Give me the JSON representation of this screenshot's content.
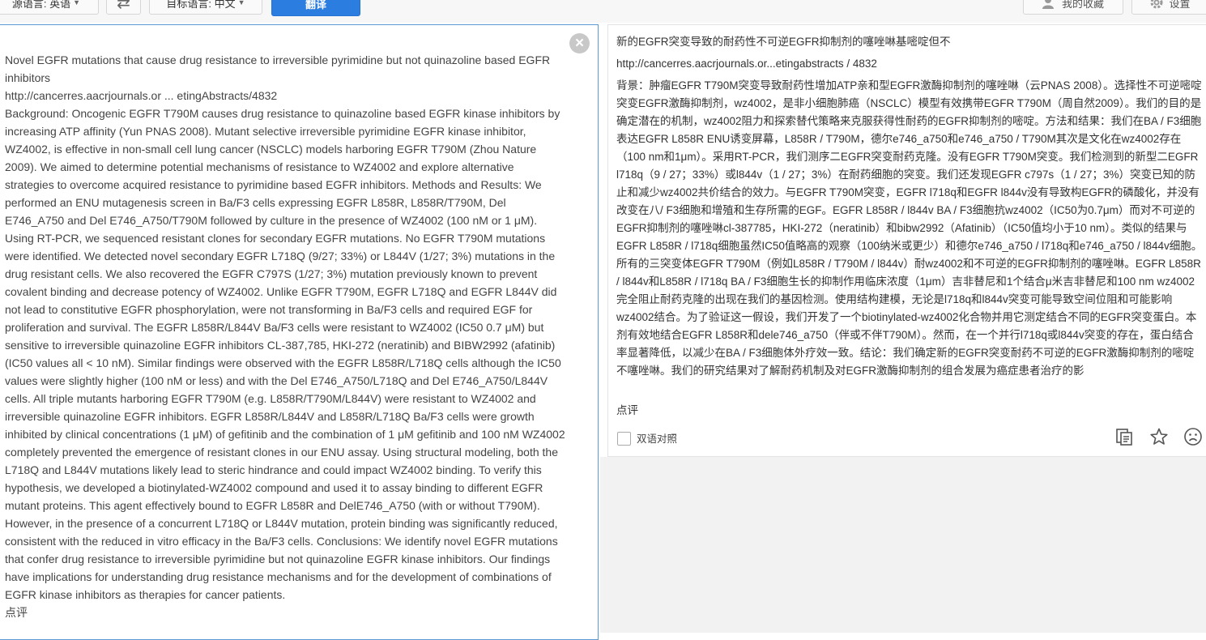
{
  "toolbar": {
    "source_language": "源语言: 英语",
    "target_language": "目标语言: 中文",
    "translate_label": "翻译",
    "favorites_label": "我的收藏",
    "settings_label": "设置"
  },
  "source": {
    "paragraphs": [
      "Novel EGFR mutations that cause drug resistance to irreversible pyrimidine but not quinazoline based EGFR inhibitors",
      "http://cancerres.aacrjournals.or ... etingAbstracts/4832",
      "Background: Oncogenic EGFR T790M causes drug resistance to quinazoline based EGFR kinase inhibitors by increasing ATP affinity (Yun PNAS 2008). Mutant selective irreversible pyrimidine EGFR kinase inhibitor, WZ4002, is effective in non-small cell lung cancer (NSCLC) models harboring EGFR T790M (Zhou Nature 2009). We aimed to determine potential mechanisms of resistance to WZ4002 and explore alternative strategies to overcome acquired resistance to pyrimidine based EGFR inhibitors. Methods and Results: We performed an ENU mutagenesis screen in Ba/F3 cells expressing EGFR L858R, L858R/T790M, Del E746_A750 and Del E746_A750/T790M followed by culture in the presence of WZ4002 (100 nM or 1 μM). Using RT-PCR, we sequenced resistant clones for secondary EGFR mutations. No EGFR T790M mutations were identified. We detected novel secondary EGFR L718Q (9/27; 33%) or L844V (1/27; 3%) mutations in the drug resistant cells. We also recovered the EGFR C797S (1/27; 3%) mutation previously known to prevent covalent binding and decrease potency of WZ4002. Unlike EGFR T790M, EGFR L718Q and EGFR L844V did not lead to constitutive EGFR phosphorylation, were not transforming in Ba/F3 cells and required EGF for proliferation and survival. The EGFR L858R/L844V Ba/F3 cells were resistant to WZ4002 (IC50 0.7 μM) but sensitive to irreversible quinazoline EGFR inhibitors CL-387,785, HKI-272 (neratinib) and BIBW2992 (afatinib) (IC50 values all < 10 nM). Similar findings were observed with the EGFR L858R/L718Q cells although the IC50 values were slightly higher (100 nM or less) and with the Del E746_A750/L718Q and Del E746_A750/L844V cells. All triple mutants harboring EGFR T790M (e.g. L858R/T790M/L844V) were resistant to WZ4002 and irreversible quinazoline EGFR inhibitors. EGFR L858R/L844V and L858R/L718Q Ba/F3 cells were growth inhibited by clinical concentrations (1 μM) of gefitinib and the combination of 1 μM gefitinib and 100 nM WZ4002 completely prevented the emergence of resistant clones in our ENU assay. Using structural modeling, both the L718Q and L844V mutations likely lead to steric hindrance and could impact WZ4002 binding. To verify this hypothesis, we developed a biotinylated-WZ4002 compound and used it to assay binding to different EGFR mutant proteins. This agent effectively bound to EGFR L858R and DelE746_A750 (with or without T790M). However, in the presence of a concurrent L718Q or L844V mutation, protein binding was significantly reduced, consistent with the reduced in vitro efficacy in the Ba/F3 cells. Conclusions: We identify novel EGFR mutations that confer drug resistance to irreversible pyrimidine but not quinazoline EGFR kinase inhibitors. Our findings have implications for understanding drug resistance mechanisms and for the development of combinations of EGFR kinase inhibitors as therapies for cancer patients.",
      "点评"
    ]
  },
  "result": {
    "title": "新的EGFR突变导致的耐药性不可逆EGFR抑制剂的噻唑啉基嘧啶但不",
    "link": "http://cancerres.aacrjournals.or...etingabstracts / 4832",
    "body": "背景：肿瘤EGFR T790M突变导致耐药性增加ATP亲和型EGFR激酶抑制剂的噻唑啉（云PNAS 2008）。选择性不可逆嘧啶突变EGFR激酶抑制剂，wz4002，是非小细胞肺癌（NSCLC）模型有效携带EGFR T790M（周自然2009）。我们的目的是确定潜在的机制，wz4002阻力和探索替代策略来克服获得性耐药的EGFR抑制剂的嘧啶。方法和结果：我们在BA / F3细胞表达EGFR L858R ENU诱变屏幕，L858R / T790M，德尔e746_a750和e746_a750 / T790M其次是文化在wz4002存在（100 nm和1μm）。采用RT-PCR，我们测序二EGFR突变耐药克隆。没有EGFR T790M突变。我们检测到的新型二EGFR l718q（9 / 27；33%）或l844v（1 / 27；3%）在耐药细胞的突变。我们还发现EGFR c797s（1 / 27；3%）突变已知的防止和减少wz4002共价结合的效力。与EGFR T790M突变，EGFR l718q和EGFR l844v没有导致构EGFR的磷酸化，并没有改变在八/ F3细胞和增殖和生存所需的EGF。EGFR L858R / l844v BA / F3细胞抗wz4002（IC50为0.7μm）而对不可逆的EGFR抑制剂的噻唑啉cl-387785，HKI-272（neratinib）和bibw2992（Afatinib）（IC50值均小于10 nm）。类似的结果与EGFR L858R / l718q细胞虽然IC50值略高的观察（100纳米或更少）和德尔e746_a750 / l718q和e746_a750 / l844v细胞。所有的三突变体EGFR T790M（例如L858R / T790M / l844v）耐wz4002和不可逆的EGFR抑制剂的噻唑啉。EGFR L858R / l844v和L858R / l718q BA / F3细胞生长的抑制作用临床浓度（1μm）吉非替尼和1个结合μ米吉非替尼和100 nm wz4002完全阻止耐药克隆的出现在我们的基因检测。使用结构建模，无论是l718q和l844v突变可能导致空间位阻和可能影响wz4002结合。为了验证这一假设，我们开发了一个biotinylated-wz4002化合物并用它测定结合不同的EGFR突变蛋白。本剂有效地结合EGFR L858R和dele746_a750（伴或不伴T790M）。然而，在一个并行l718q或l844v突变的存在，蛋白结合率显著降低，以减少在BA / F3细胞体外疗效一致。结论：我们确定新的EGFR突变耐药不可逆的EGFR激酶抑制剂的嘧啶不噻唑啉。我们的研究结果对了解耐药机制及对EGFR激酶抑制剂的组合发展为癌症患者治疗的影",
    "comment": "点评",
    "bilingual_label": "双语对照"
  },
  "icons": [
    "chevron-down-icon",
    "swap-arrows-icon",
    "close-icon",
    "favorites-icon",
    "gear-icon",
    "copy-icon",
    "star-icon",
    "sad-face-icon"
  ],
  "colors": {
    "accent": "#2b7ee0",
    "active_border": "#5b9bd5"
  }
}
